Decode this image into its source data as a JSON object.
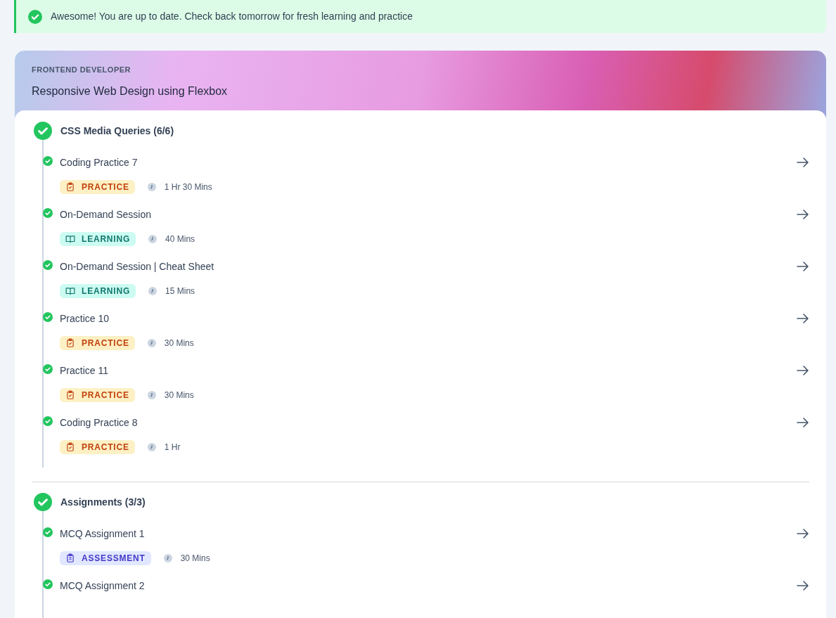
{
  "banner": {
    "message": "Awesome! You are up to date. Check back tomorrow for fresh learning and practice"
  },
  "course": {
    "track": "FRONTEND DEVELOPER",
    "title": "Responsive Web Design using Flexbox",
    "sections": [
      {
        "title": "CSS Media Queries (6/6)",
        "completed": true,
        "items": [
          {
            "title": "Coding Practice 7",
            "completed": true,
            "tag": {
              "kind": "practice",
              "label": "PRACTICE"
            },
            "duration": "1 Hr 30 Mins"
          },
          {
            "title": "On-Demand Session",
            "completed": true,
            "tag": {
              "kind": "learning",
              "label": "LEARNING"
            },
            "duration": "40 Mins"
          },
          {
            "title": "On-Demand Session | Cheat Sheet",
            "completed": true,
            "tag": {
              "kind": "learning",
              "label": "LEARNING"
            },
            "duration": "15 Mins"
          },
          {
            "title": "Practice 10",
            "completed": true,
            "tag": {
              "kind": "practice",
              "label": "PRACTICE"
            },
            "duration": "30 Mins"
          },
          {
            "title": "Practice 11",
            "completed": true,
            "tag": {
              "kind": "practice",
              "label": "PRACTICE"
            },
            "duration": "30 Mins"
          },
          {
            "title": "Coding Practice 8",
            "completed": true,
            "tag": {
              "kind": "practice",
              "label": "PRACTICE"
            },
            "duration": "1 Hr"
          }
        ]
      },
      {
        "title": "Assignments (3/3)",
        "completed": true,
        "items": [
          {
            "title": "MCQ Assignment 1",
            "completed": true,
            "tag": {
              "kind": "assessment",
              "label": "ASSESSMENT"
            },
            "duration": "30 Mins"
          },
          {
            "title": "MCQ Assignment 2",
            "completed": true
          }
        ]
      }
    ]
  }
}
